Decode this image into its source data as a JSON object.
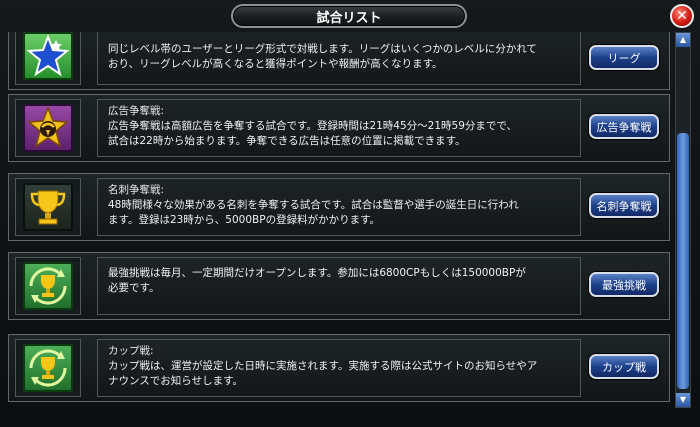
{
  "window": {
    "title": "試合リスト",
    "close_glyph": "✕"
  },
  "rows": [
    {
      "icon": "blue-star-icon",
      "title": "",
      "lines": [
        "同じレベル帯のユーザーとリーグ形式で対戦します。リーグはいくつかのレベルに分かれて",
        "おり、リーグレベルが高くなると獲得ポイントや報酬が高くなります。"
      ],
      "button": "リーグ"
    },
    {
      "icon": "star-emblem-icon",
      "title": "広告争奪戦:",
      "lines": [
        "広告争奪戦は高額広告を争奪する試合です。登録時間は21時45分～21時59分までで、",
        "試合は22時から始まります。争奪できる広告は任意の位置に掲載できます。"
      ],
      "button": "広告争奪戦"
    },
    {
      "icon": "trophy-icon",
      "title": "名刺争奪戦:",
      "lines": [
        "48時間様々な効果がある名刺を争奪する試合です。試合は監督や選手の誕生日に行われ",
        "ます。登録は23時から、5000BPの登録料がかかります。"
      ],
      "button": "名刺争奪戦"
    },
    {
      "icon": "trophy-cycle-icon",
      "title": "",
      "lines": [
        "最強挑戦は毎月、一定期間だけオープンします。参加には6800CPもしくは150000BPが",
        "必要です。"
      ],
      "button": "最強挑戦"
    },
    {
      "icon": "trophy-cycle-icon",
      "title": "カップ戦:",
      "lines": [
        "カップ戦は、運営が設定した日時に実施されます。実施する際は公式サイトのお知らせやア",
        "ナウンスでお知らせします。"
      ],
      "button": "カップ戦"
    }
  ],
  "scrollbar": {
    "up_glyph": "▲",
    "down_glyph": "▼"
  },
  "colors": {
    "button_blue": "#1d3f8a",
    "close_red": "#d21a12",
    "text": "#f0f0f0"
  }
}
